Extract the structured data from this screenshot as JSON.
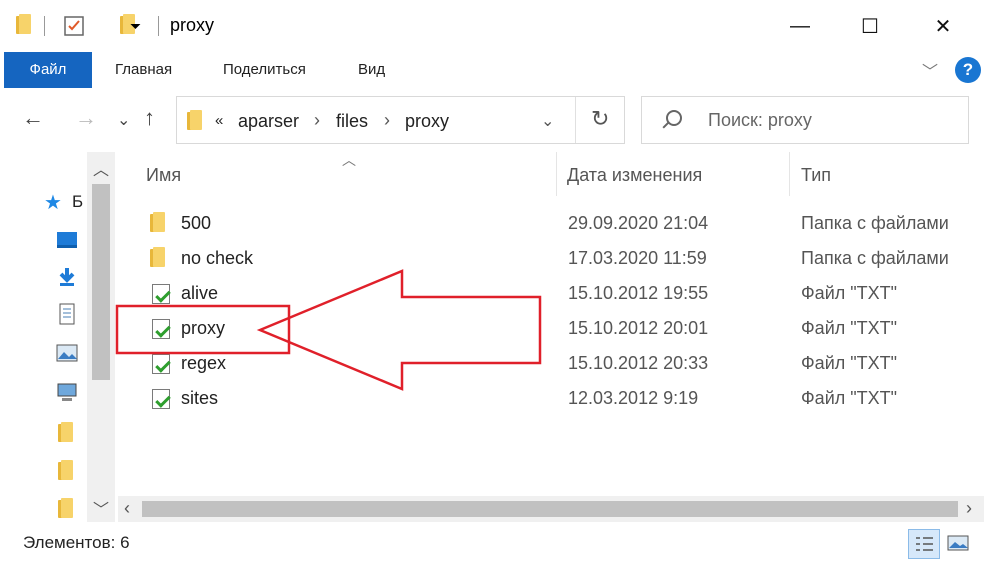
{
  "window": {
    "title": "proxy",
    "minimize": "—",
    "maximize": "☐",
    "close": "✕"
  },
  "ribbon": {
    "tabs": [
      "Файл",
      "Главная",
      "Поделиться",
      "Вид"
    ],
    "help": "?"
  },
  "nav": {
    "back": "←",
    "forward": "→",
    "recent": "⌄",
    "up": "↑",
    "breadcrumb": [
      "«",
      "aparser",
      "files",
      "proxy"
    ],
    "refresh": "↻",
    "search_placeholder": "Поиск: proxy"
  },
  "columns": {
    "name": "Имя",
    "date": "Дата изменения",
    "type": "Тип"
  },
  "files": [
    {
      "name": "500",
      "date": "29.09.2020 21:04",
      "type": "Папка с файлами",
      "kind": "folder"
    },
    {
      "name": "no check",
      "date": "17.03.2020 11:59",
      "type": "Папка с файлами",
      "kind": "folder"
    },
    {
      "name": "alive",
      "date": "15.10.2012 19:55",
      "type": "Файл \"TXT\"",
      "kind": "txt"
    },
    {
      "name": "proxy",
      "date": "15.10.2012 20:01",
      "type": "Файл \"TXT\"",
      "kind": "txt"
    },
    {
      "name": "regex",
      "date": "15.10.2012 20:33",
      "type": "Файл \"TXT\"",
      "kind": "txt"
    },
    {
      "name": "sites",
      "date": "12.03.2012 9:19",
      "type": "Файл \"TXT\"",
      "kind": "txt"
    }
  ],
  "left_pane": {
    "quick_access_label": "Б"
  },
  "status": {
    "items_count": "Элементов: 6"
  },
  "colors": {
    "file_tab": "#1565c0",
    "annotation": "#e0202a"
  }
}
